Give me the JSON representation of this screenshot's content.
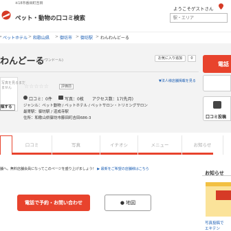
{
  "header": {
    "top_text": "※18市番目町吉田",
    "logo_text": "ペット・動物の口コミ検索",
    "welcome": "ようこそゲストさん",
    "search_placeholder": "駅・エリア"
  },
  "breadcrumb": [
    {
      "label": "ペットホテル"
    },
    {
      "label": "和歌山県"
    },
    {
      "label": "御坊市"
    },
    {
      "label": "御坊駅"
    }
  ],
  "breadcrumb_sep": ">",
  "breadcrumb_current": "わんわんどーる",
  "shop": {
    "title": "わんどーる",
    "subtitle": "(ワンワンドール)",
    "favorite_button": "お気に入り追加",
    "favorite_count": "0",
    "biz_link": "▼法人様店舗掲載を見る",
    "photo_text_1": "写真を見るまだ",
    "photo_text_2": "ません",
    "photo_button": "稿する",
    "stars": "☆☆☆☆☆",
    "rating_badge": "評価前",
    "review_line": "口コミ：0件",
    "photo_line": "写真：0枚",
    "access_line": "アクセス数：17(先月)",
    "genre": "ジャンル：ペット動物 / ペットホテル / ペットサロン・トリミングサロン",
    "station": "最寄駅：御坊駅 / 道成寺駅",
    "address": "住所：和歌山県御坊市藤田町吉田686-3"
  },
  "right_column": {
    "tel_label": "電話",
    "review_post_label": "口コミ投稿"
  },
  "tabs": [
    "トップ",
    "口コミ",
    "写真",
    "イチオシ",
    "メニュー",
    "お知らせ",
    "地図"
  ],
  "notice": {
    "text": "舗へ。無料店舗会員になってこのページを盛り上げましょう！",
    "link": "最新をご希望の店舗様はこちら"
  },
  "actions": {
    "tel_button": "電話で予約・お問い合わせ",
    "map_button": "地図"
  },
  "sidebar": {
    "title": "お知らせ",
    "links": [
      "写真投稿で",
      "エキテン"
    ]
  },
  "colors": {
    "accent": "#e8432d",
    "link": "#1a5eb4"
  }
}
